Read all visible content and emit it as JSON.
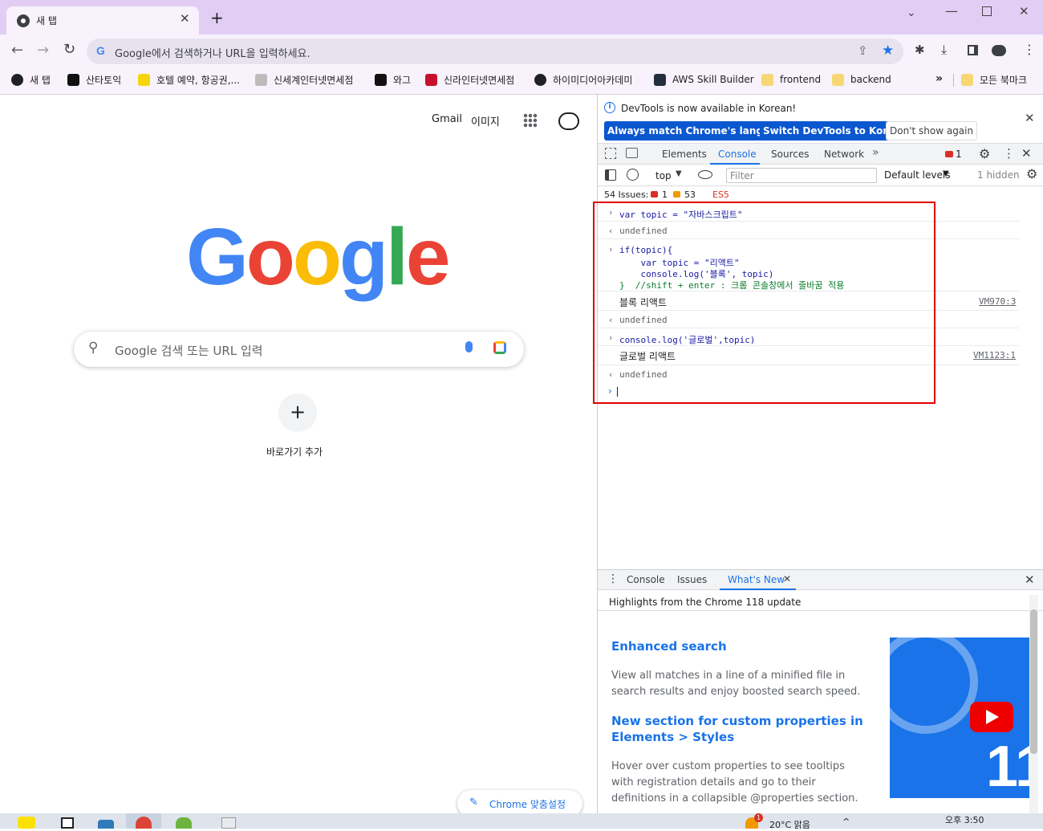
{
  "browser": {
    "tab_title": "새 탭",
    "omnibox_placeholder": "Google에서 검색하거나 URL을 입력하세요.",
    "bookmarks": [
      {
        "label": "새 탭",
        "color": "#202124"
      },
      {
        "label": "산타토익",
        "color": "#111111"
      },
      {
        "label": "호텔 예약, 항공권,...",
        "color": "#f5d50a"
      },
      {
        "label": "신세계인터넷면세점",
        "color": "#bbbbbb"
      },
      {
        "label": "와그",
        "color": "#111111"
      },
      {
        "label": "신라인터넷면세점",
        "color": "#c8102e"
      },
      {
        "label": "하이미디어아카데미",
        "color": "#202124"
      },
      {
        "label": "AWS Skill Builder",
        "color": "#232f3e"
      },
      {
        "label": "frontend",
        "color": "#f7d774"
      },
      {
        "label": "backend",
        "color": "#f7d774"
      }
    ],
    "more_bookmarks": "»",
    "all_bookmarks": "모든 북마크"
  },
  "newtab": {
    "gmail": "Gmail",
    "images": "이미지",
    "logo_letters": [
      "G",
      "o",
      "o",
      "g",
      "l",
      "e"
    ],
    "logo_colors": [
      "#4285f4",
      "#ea4335",
      "#fbbc05",
      "#4285f4",
      "#34a853",
      "#ea4335"
    ],
    "search_placeholder": "Google 검색 또는 URL 입력",
    "add_shortcut_icon": "+",
    "add_shortcut_label": "바로가기 추가",
    "customize": "Chrome 맞춤설정"
  },
  "devtools": {
    "infobar_text": "DevTools is now available in Korean!",
    "btn_match": "Always match Chrome's language",
    "btn_switch": "Switch DevTools to Korean",
    "btn_dont_show": "Don't show again",
    "tabs": [
      "Elements",
      "Console",
      "Sources",
      "Network"
    ],
    "active_tab": "Console",
    "error_count": "1",
    "context": "top",
    "filter_placeholder": "Filter",
    "levels": "Default levels",
    "hidden": "1 hidden",
    "issues_label": "54 Issues:",
    "issues_errors": "1",
    "issues_warnings": "53",
    "es5": "ES5",
    "console": {
      "in1": "var topic = \"자바스크립트\"",
      "out_undefined": "undefined",
      "in2_l1": "if(topic){",
      "in2_l2": "    var topic = \"리액트\"",
      "in2_l3": "    console.log('블록', topic)",
      "in2_l4": "}  //shift + enter : 크롬 콘솔창에서 줄바꿈 적용",
      "log1": "블록 리액트",
      "log1_src": "VM970:3",
      "in3": "console.log('글로벌',topic)",
      "log2": "글로벌 리액트",
      "log2_src": "VM1123:1"
    },
    "drawer_tabs": [
      "Console",
      "Issues",
      "What's New"
    ],
    "highlights": "Highlights from the Chrome 118 update",
    "wn1_title": "Enhanced search",
    "wn1_body_l1": "View all matches in a line of a minified file in",
    "wn1_body_l2": "search results and enjoy boosted search speed.",
    "wn2_title_l1": "New section for custom properties in",
    "wn2_title_l2": "Elements > Styles",
    "wn3_body_l1": "Hover over custom properties to see tooltips",
    "wn3_body_l2": "with registration details and go to their",
    "wn3_body_l3": "definitions in a collapsible @properties section.",
    "video_text": "11"
  },
  "taskbar": {
    "weather": "20°C 맑음",
    "time": "오후 3:50",
    "badge": "1"
  }
}
